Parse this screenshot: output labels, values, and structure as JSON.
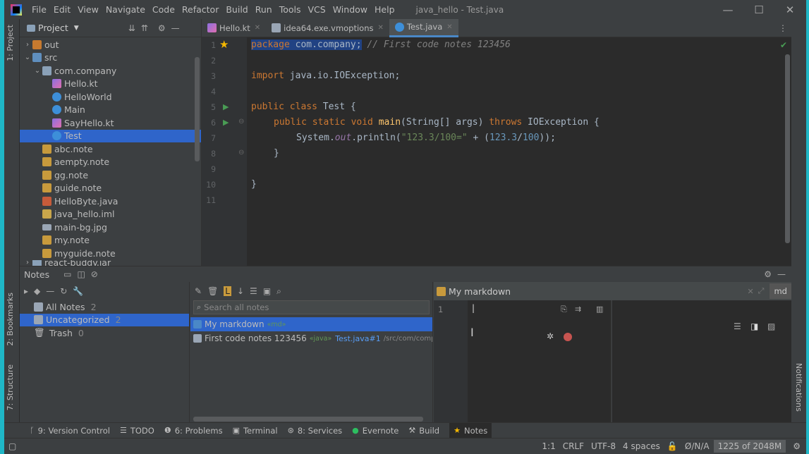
{
  "menu": {
    "items": [
      "File",
      "Edit",
      "View",
      "Navigate",
      "Code",
      "Refactor",
      "Build",
      "Run",
      "Tools",
      "VCS",
      "Window",
      "Help"
    ],
    "title": "java_hello - Test.java"
  },
  "left_strip": {
    "project": "1: Project",
    "bookmarks": "2: Bookmarks",
    "structure": "7: Structure"
  },
  "right_strip": {
    "notifications": "Notifications"
  },
  "project": {
    "header": "Project",
    "tree": [
      {
        "label": "out",
        "icon": "folder-orange-icon"
      },
      {
        "label": "src",
        "icon": "folder-blue-icon"
      },
      {
        "label": "com.company",
        "icon": "package-icon"
      },
      {
        "label": "Hello.kt",
        "icon": "kotlin-file-icon"
      },
      {
        "label": "HelloWorld",
        "icon": "java-class-icon"
      },
      {
        "label": "Main",
        "icon": "java-class-icon"
      },
      {
        "label": "SayHello.kt",
        "icon": "kotlin-file-icon"
      },
      {
        "label": "Test",
        "icon": "java-class-icon"
      },
      {
        "label": "abc.note",
        "icon": "note-file-icon"
      },
      {
        "label": "aempty.note",
        "icon": "note-file-icon"
      },
      {
        "label": "gg.note",
        "icon": "note-file-icon"
      },
      {
        "label": "guide.note",
        "icon": "note-file-icon"
      },
      {
        "label": "HelloByte.java",
        "icon": "java-file-icon"
      },
      {
        "label": "java_hello.iml",
        "icon": "iml-file-icon"
      },
      {
        "label": "main-bg.jpg",
        "icon": "image-file-icon"
      },
      {
        "label": "my.note",
        "icon": "note-file-icon"
      },
      {
        "label": "myguide.note",
        "icon": "note-file-icon"
      },
      {
        "label": "react-buddy.jar",
        "icon": "jar-file-icon"
      }
    ]
  },
  "editor": {
    "tabs": [
      {
        "label": "Hello.kt",
        "icon": "kotlin-file-icon"
      },
      {
        "label": "idea64.exe.vmoptions",
        "icon": "settings-file-icon"
      },
      {
        "label": "Test.java",
        "icon": "java-class-icon"
      }
    ],
    "line_numbers": [
      "1",
      "2",
      "3",
      "4",
      "5",
      "6",
      "7",
      "8",
      "9",
      "10",
      "11"
    ],
    "code": {
      "l1_kw": "package",
      "l1_pkg": " com.company;",
      "l1_cm": " // First code notes 123456",
      "l3_kw": "import",
      "l3_rest": " java.io.IOException;",
      "l5_kw": "public class",
      "l5_rest": " Test {",
      "l6_kw": "public static void",
      "l6_fn": " main",
      "l6_args": "(String[] args) ",
      "l6_throws": "throws",
      "l6_rest": " IOException {",
      "l7_a": "System.",
      "l7_out": "out",
      "l7_b": ".println(",
      "l7_str": "\"123.3/100=\"",
      "l7_c": " + (",
      "l7_n1": "123.3",
      "l7_d": "/",
      "l7_n2": "100",
      "l7_e": "));",
      "l8": "}",
      "l10": "}"
    }
  },
  "notes": {
    "title": "Notes",
    "categories": [
      {
        "label": "All Notes",
        "count": "2"
      },
      {
        "label": "Uncategorized",
        "count": "2"
      },
      {
        "label": "Trash",
        "count": "0"
      }
    ],
    "search_placeholder": "Search all notes",
    "list": [
      {
        "title": "My markdown",
        "tag": "«md»"
      },
      {
        "title": "First code notes 123456",
        "tag": "«java»",
        "link": "Test.java#1",
        "path": "/src/com/compan"
      }
    ],
    "editor_title": "My markdown",
    "editor_mode": "md",
    "editor_line": "1"
  },
  "toolwindows": [
    {
      "label": "9: Version Control",
      "icon": "vcs-icon"
    },
    {
      "label": "TODO",
      "icon": "list-icon"
    },
    {
      "label": "6: Problems",
      "icon": "info-icon"
    },
    {
      "label": "Terminal",
      "icon": "terminal-icon"
    },
    {
      "label": "8: Services",
      "icon": "services-icon"
    },
    {
      "label": "Evernote",
      "icon": "evernote-icon"
    },
    {
      "label": "Build",
      "icon": "hammer-icon"
    },
    {
      "label": "Notes",
      "icon": "star-icon"
    }
  ],
  "status": {
    "position": "1:1",
    "line_sep": "CRLF",
    "encoding": "UTF-8",
    "indent": "4 spaces",
    "vcs": "Ø/N/A",
    "memory": "1225 of 2048M"
  }
}
